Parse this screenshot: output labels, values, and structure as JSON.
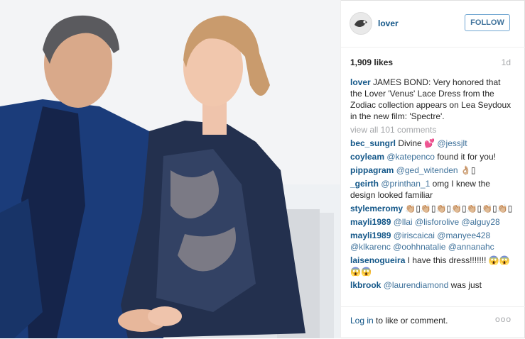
{
  "post": {
    "username": "lover",
    "follow_label": "FOLLOW",
    "likes": "1,909 likes",
    "age": "1d",
    "caption_user": "lover",
    "caption": "JAMES BOND: Very honored that the Lover 'Venus' Lace Dress from the Zodiac collection appears on Lea Seydoux in the new film: 'Spectre'.",
    "view_all": "view all 101 comments"
  },
  "comments": [
    {
      "user": "bec_sungrl",
      "text": "Divine 💕 ",
      "mention": "@jessjlt"
    },
    {
      "user": "coyleam",
      "mention": "@katepenco",
      "text": " found it for you!"
    },
    {
      "user": "pippagram",
      "mention": "@ged_witenden",
      "text": " 👌🏼▯"
    },
    {
      "user": "_geirth",
      "mention": "@printhan_1",
      "text": " omg I knew the design looked familiar"
    },
    {
      "user": "stylemeromy",
      "text": "👏🏼▯👏🏼▯👏🏼▯👏🏼▯👏🏼▯👏🏼▯👏🏼▯"
    },
    {
      "user": "mayli1989",
      "mention": "@llai @lisforolive @alguy28",
      "text": ""
    },
    {
      "user": "mayli1989",
      "mention": "@iriscaicai @manyee428 @klkarenc @oohhnatalie @annanahc",
      "text": ""
    },
    {
      "user": "laisenogueira",
      "text": "I have this dress!!!!!!! 😱😱😱😱"
    },
    {
      "user": "lkbrook",
      "mention": "@laurendiamond",
      "text": " was just"
    }
  ],
  "footer": {
    "login_link": "Log in",
    "login_rest": " to like or comment.",
    "more": "ooo"
  },
  "icons": {
    "avatar": "avatar-icon",
    "more": "more-options-icon"
  }
}
